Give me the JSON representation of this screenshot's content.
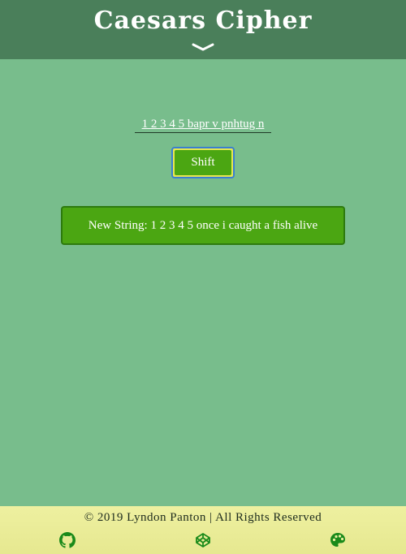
{
  "header": {
    "title": "Caesars Cipher",
    "chevron_icon": "chevron-down-icon"
  },
  "cipher": {
    "input_value": "1 2 3 4 5 bapr v pnhtug n",
    "shift_label": "Shift",
    "result_text": "New String: 1 2 3 4 5 once i caught a fish alive"
  },
  "footer": {
    "copyright": "© 2019 Lyndon Panton | All Rights Reserved",
    "icons": [
      "github-icon",
      "codepen-icon",
      "palette-icon"
    ]
  },
  "colors": {
    "background": "#78bd8c",
    "header": "#4a7f5a",
    "accent_green": "#4ba612",
    "footer": "#eef0a0"
  }
}
